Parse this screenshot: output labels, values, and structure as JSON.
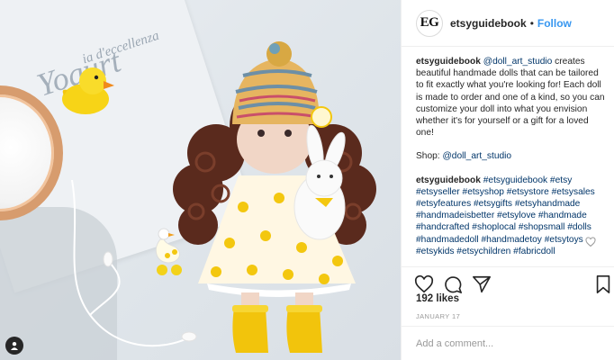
{
  "photo": {
    "magazine_line1": "ia d'eccellenza",
    "magazine_line2": "Yogurt"
  },
  "header": {
    "logo_text": "EG",
    "username": "etsyguidebook",
    "separator": "•",
    "follow_label": "Follow"
  },
  "caption": {
    "username": "etsyguidebook",
    "mention": "@doll_art_studio",
    "body": " creates beautiful handmade dolls that can be tailored to fit exactly what you're looking for! Each doll is made to order and one of a kind, so you can customize your doll into what you envision whether it's for yourself or a gift for a loved one!",
    "shop_label": "Shop: ",
    "shop_handle": "@doll_art_studio",
    "comment_username": "etsyguidebook",
    "hashtags": "#etsyguidebook #etsy #etsyseller #etsyshop #etsystore #etsysales #etsyfeatures #etsygifts #etsyhandmade #handmadeisbetter #etsylove #handmade #handcrafted #shoplocal #shopsmall #dolls #handmadedoll #handmadetoy #etsytoys #etsykids #etsychildren #fabricdoll"
  },
  "actions": {
    "like_icon": "heart-icon",
    "comment_icon": "comment-icon",
    "share_icon": "share-icon",
    "save_icon": "bookmark-icon"
  },
  "likes_text": "192 likes",
  "date_text": "JANUARY 17",
  "comment_placeholder": "Add a comment...",
  "colors": {
    "follow_blue": "#3897f0",
    "link_blue": "#003569",
    "border": "#efefef",
    "muted": "#999999"
  }
}
